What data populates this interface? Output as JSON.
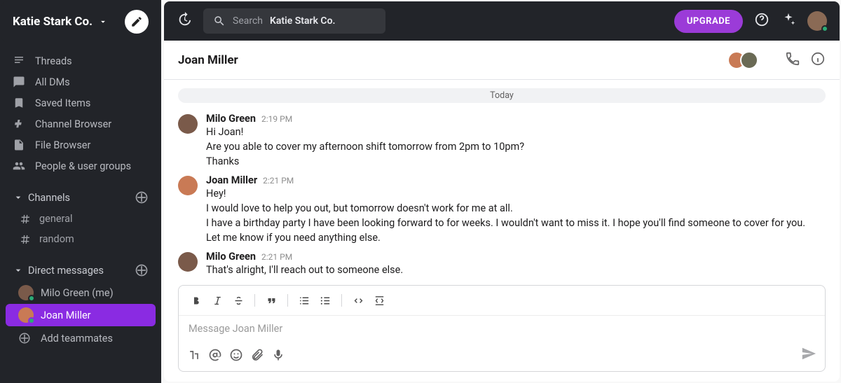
{
  "workspace": {
    "name": "Katie Stark Co."
  },
  "sidebar": {
    "nav": {
      "threads": "Threads",
      "all_dms": "All DMs",
      "saved": "Saved Items",
      "channel_browser": "Channel Browser",
      "file_browser": "File Browser",
      "people": "People & user groups"
    },
    "channels_section": "Channels",
    "channels": [
      {
        "name": "general"
      },
      {
        "name": "random"
      }
    ],
    "dms_section": "Direct messages",
    "dms": [
      {
        "label": "Milo Green (me)"
      },
      {
        "label": "Joan Miller"
      }
    ],
    "add_teammates": "Add teammates"
  },
  "topbar": {
    "search_static": "Search",
    "search_value": "Katie Stark Co.",
    "upgrade": "UPGRADE"
  },
  "conversation": {
    "title": "Joan Miller",
    "date_label": "Today",
    "messages": [
      {
        "author": "Milo Green",
        "time": "2:19 PM",
        "lines": [
          "Hi Joan!",
          "Are you able to cover my afternoon shift tomorrow from 2pm to 10pm?",
          "Thanks"
        ]
      },
      {
        "author": "Joan Miller",
        "time": "2:21 PM",
        "lines": [
          "Hey!",
          "I would love to help you out, but tomorrow doesn't work for me at all.",
          "I have a birthday party I have been looking forward to for weeks. I wouldn't want to miss it. I hope you'll find someone to cover for you.",
          "Let me know if you need anything else."
        ]
      },
      {
        "author": "Milo Green",
        "time": "2:21 PM",
        "lines": [
          "That's alright, I'll reach out to someone else."
        ]
      }
    ]
  },
  "composer": {
    "placeholder": "Message Joan Miller"
  }
}
